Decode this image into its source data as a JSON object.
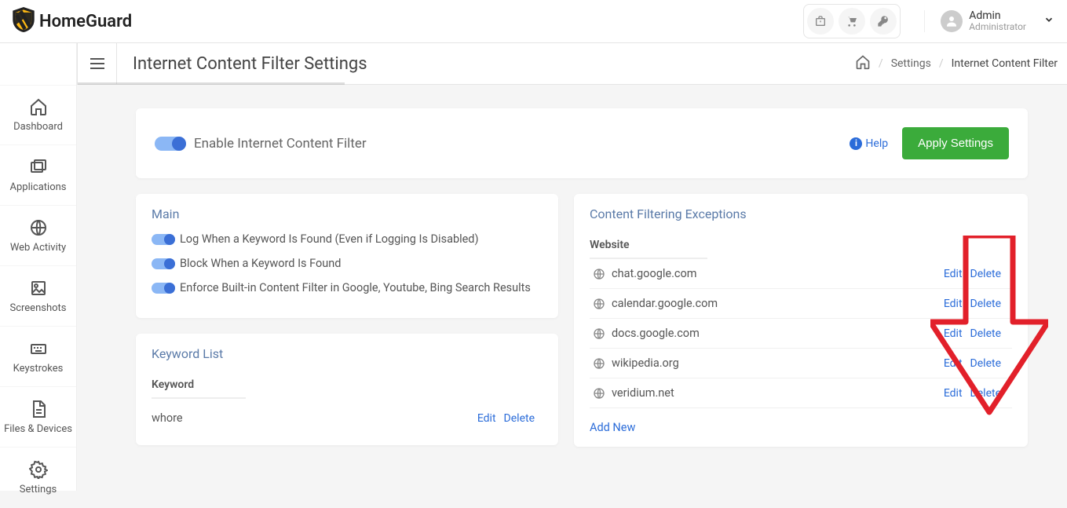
{
  "brand": "HomeGuard",
  "user": {
    "name": "Admin",
    "role": "Administrator"
  },
  "page_title": "Internet Content Filter Settings",
  "breadcrumb": {
    "mid": "Settings",
    "last": "Internet Content Filter"
  },
  "sidebar": {
    "items": [
      {
        "label": "Dashboard"
      },
      {
        "label": "Applications"
      },
      {
        "label": "Web Activity"
      },
      {
        "label": "Screenshots"
      },
      {
        "label": "Keystrokes"
      },
      {
        "label": "Files & Devices"
      },
      {
        "label": "Settings"
      }
    ]
  },
  "hero": {
    "toggle_label": "Enable Internet Content Filter",
    "help": "Help",
    "apply": "Apply Settings"
  },
  "main_card": {
    "title": "Main",
    "rows": [
      "Log When a Keyword Is Found (Even if Logging Is Disabled)",
      "Block When a Keyword Is Found",
      "Enforce Built-in Content Filter in Google, Youtube, Bing Search Results"
    ]
  },
  "keyword_card": {
    "title": "Keyword List",
    "header": "Keyword",
    "rows": [
      {
        "keyword": "whore"
      }
    ]
  },
  "exceptions_card": {
    "title": "Content Filtering Exceptions",
    "header": "Website",
    "rows": [
      {
        "url": "chat.google.com"
      },
      {
        "url": "calendar.google.com"
      },
      {
        "url": "docs.google.com"
      },
      {
        "url": "wikipedia.org"
      },
      {
        "url": "veridium.net"
      }
    ],
    "add_new": "Add New"
  },
  "actions": {
    "edit": "Edit",
    "delete": "Delete"
  }
}
